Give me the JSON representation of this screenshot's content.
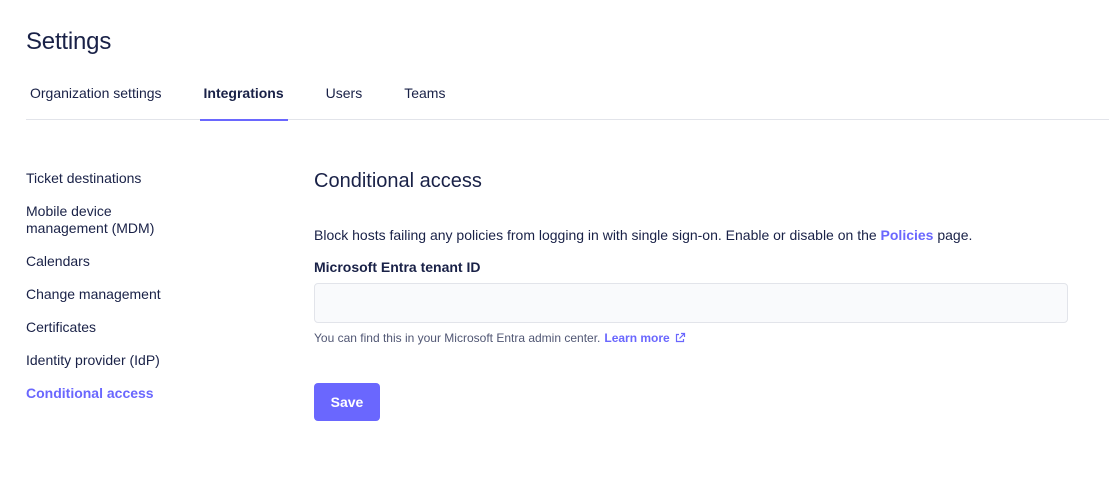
{
  "header": {
    "title": "Settings"
  },
  "tabs": [
    {
      "label": "Organization settings"
    },
    {
      "label": "Integrations",
      "active": true
    },
    {
      "label": "Users"
    },
    {
      "label": "Teams"
    }
  ],
  "sidebar": {
    "items": [
      {
        "label": "Ticket destinations"
      },
      {
        "label": "Mobile device management (MDM)"
      },
      {
        "label": "Calendars"
      },
      {
        "label": "Change management"
      },
      {
        "label": "Certificates"
      },
      {
        "label": "Identity provider (IdP)"
      },
      {
        "label": "Conditional access",
        "active": true
      }
    ]
  },
  "main": {
    "title": "Conditional access",
    "description_before": "Block hosts failing any policies from logging in with single sign-on. Enable or disable on the ",
    "description_link": "Policies",
    "description_after": " page.",
    "field_label": "Microsoft Entra tenant ID",
    "field_value": "",
    "field_placeholder": "",
    "help_text": "You can find this in your Microsoft Entra admin center.",
    "help_link": "Learn more",
    "save_label": "Save"
  },
  "colors": {
    "accent": "#6a67fe",
    "text": "#192147",
    "border": "#e2e4ea",
    "input_bg": "#f9fafc"
  },
  "icons": {
    "help_link_icon": "external-link-icon"
  }
}
